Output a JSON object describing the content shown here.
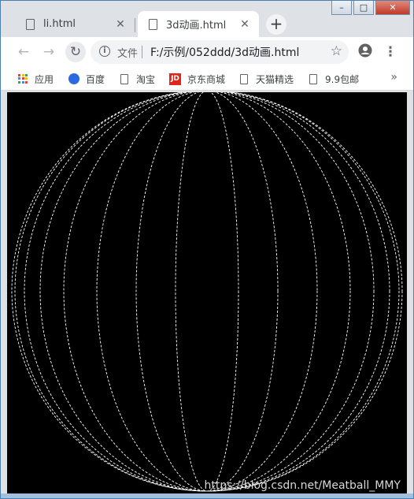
{
  "tabs": [
    {
      "title": "li.html",
      "close": "✕"
    },
    {
      "title": "3d动画.html",
      "close": "✕"
    }
  ],
  "new_tab": "+",
  "toolbar": {
    "back": "←",
    "forward": "→",
    "reload": "↻",
    "scheme_label": "文件",
    "url": "F:/示例/052ddd/3d动画.html",
    "star": "☆",
    "menu": "⋮"
  },
  "bookmarks": [
    {
      "label": "应用",
      "icon": "apps-grid-icon"
    },
    {
      "label": "百度",
      "icon": "baidu-paw-icon"
    },
    {
      "label": "淘宝",
      "icon": "page-icon"
    },
    {
      "label": "京东商城",
      "icon": "jd-logo-icon"
    },
    {
      "label": "天猫精选",
      "icon": "page-icon"
    },
    {
      "label": "9.9包邮",
      "icon": "page-icon"
    }
  ],
  "bookmarks_overflow": "»",
  "watermark": "https://blog.csdn.net/Meatball_MMY",
  "colors": {
    "viewport_bg": "#000000",
    "ellipse_stroke": "#ffffff",
    "tabbar_bg": "#dee1e6"
  }
}
